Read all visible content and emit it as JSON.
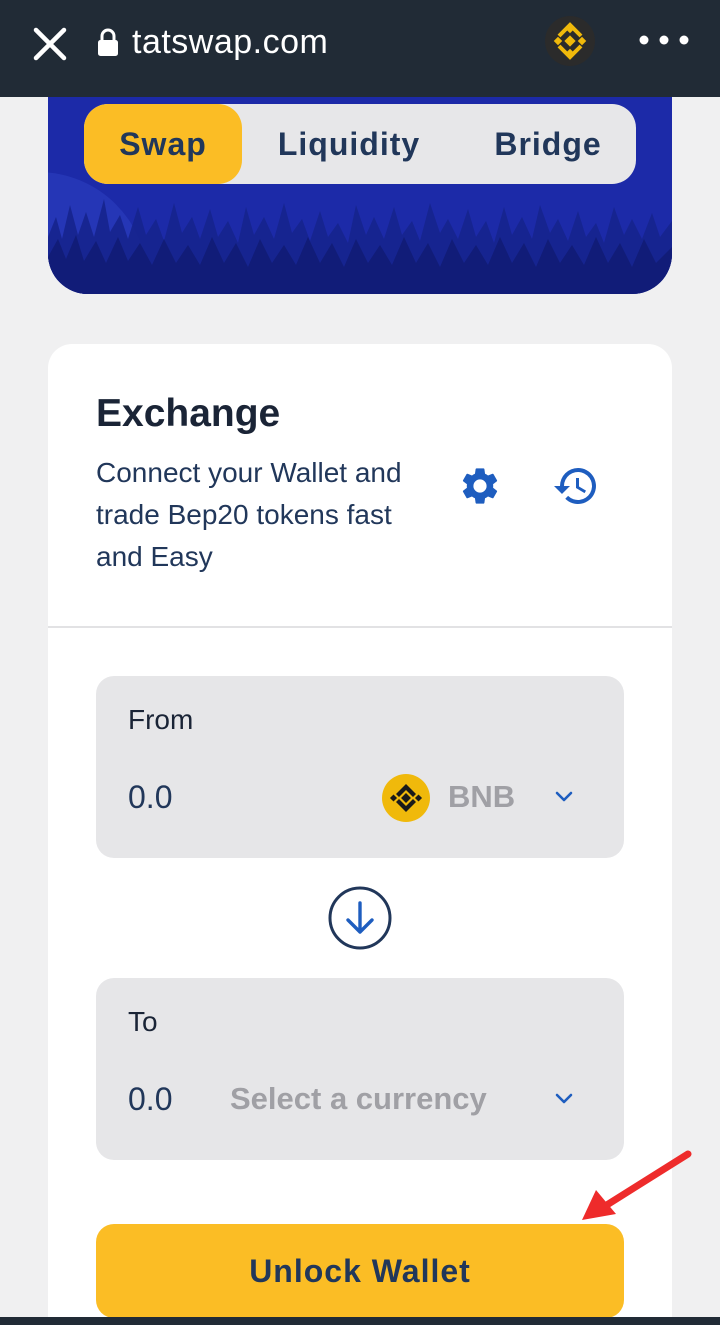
{
  "browser": {
    "url": "tatswap.com",
    "close_icon": "close-icon",
    "lock_icon": "lock-icon",
    "extension_icon": "binance-icon",
    "menu_icon": "more-dots-icon"
  },
  "tabs": [
    {
      "label": "Swap",
      "active": true
    },
    {
      "label": "Liquidity",
      "active": false
    },
    {
      "label": "Bridge",
      "active": false
    }
  ],
  "exchange": {
    "title": "Exchange",
    "description": "Connect your Wallet and trade Bep20 tokens fast and Easy",
    "settings_icon": "gear-icon",
    "history_icon": "history-icon"
  },
  "from": {
    "label": "From",
    "amount": "0.0",
    "token": "BNB",
    "token_icon": "bnb-icon"
  },
  "to": {
    "label": "To",
    "amount": "0.0",
    "currency_placeholder": "Select a currency"
  },
  "swap_direction_icon": "arrow-down-circle-icon",
  "unlock_button": "Unlock Wallet",
  "colors": {
    "accent": "#fbbd25",
    "hero": "#1c2aa8",
    "text": "#21375a",
    "browser_bar": "#212b36",
    "bnb": "#f0b90b",
    "annotation_arrow": "#ee2b2b"
  }
}
